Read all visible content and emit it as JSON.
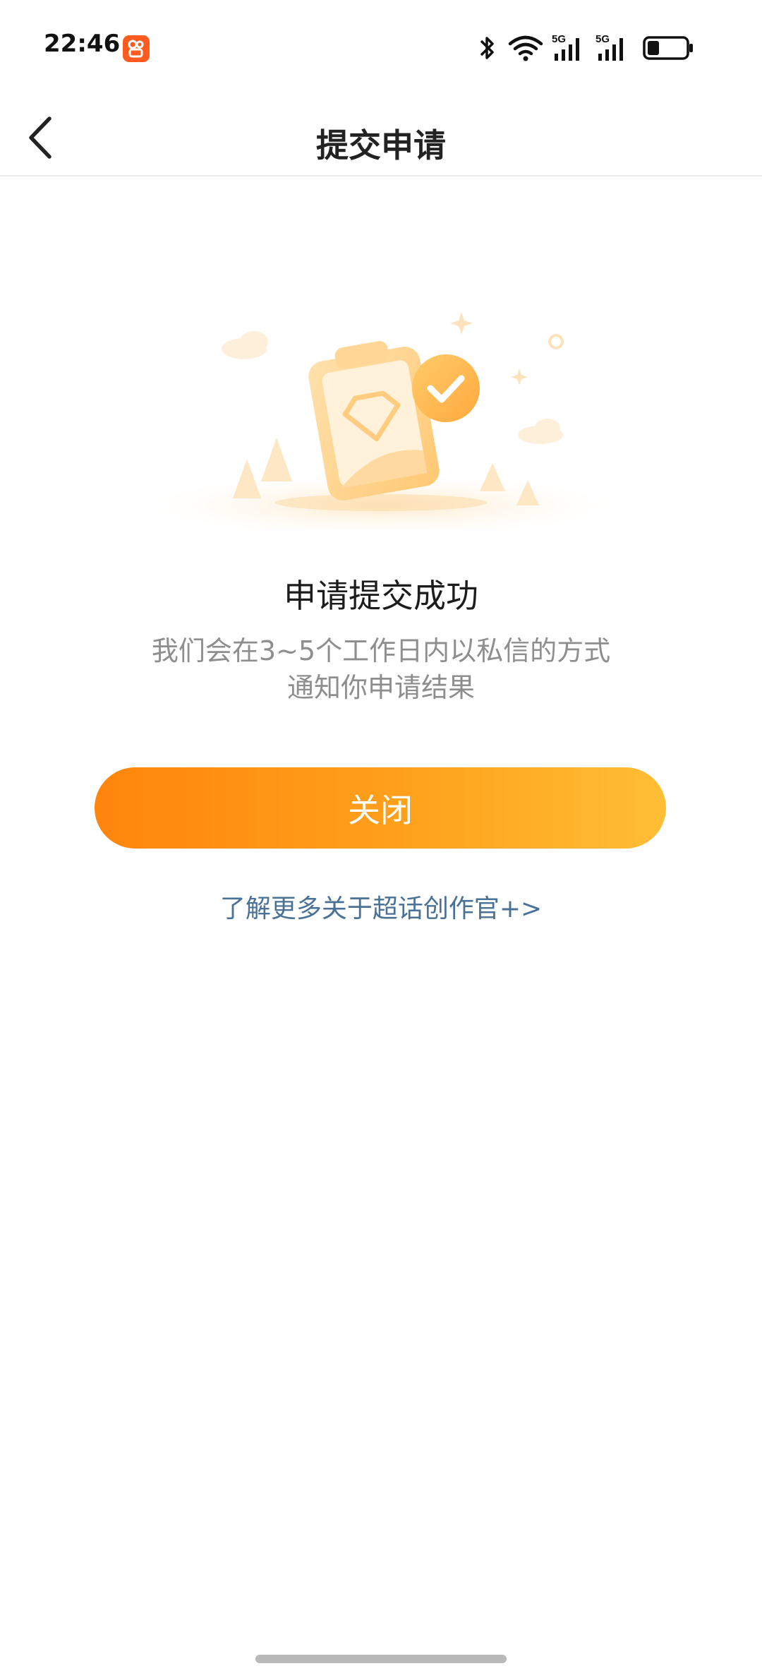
{
  "status_bar": {
    "time": "22:46",
    "icons": [
      "app-notification-icon",
      "bluetooth-icon",
      "wifi-icon",
      "5g-signal-icon",
      "5g-signal-icon",
      "battery-icon"
    ],
    "network_label_1": "5G",
    "network_label_2": "5G",
    "battery_level": 0.3
  },
  "header": {
    "title": "提交申请",
    "back_icon": "chevron-left-icon"
  },
  "result": {
    "title": "申请提交成功",
    "description_line1": "我们会在3~5个工作日内以私信的方式",
    "description_line2": "通知你申请结果"
  },
  "actions": {
    "close_label": "关闭",
    "learn_more_label": "了解更多关于超话创作官+>"
  },
  "colors": {
    "accent_start": "#ff850d",
    "accent_end": "#ffbe35",
    "link": "#4a7196"
  }
}
